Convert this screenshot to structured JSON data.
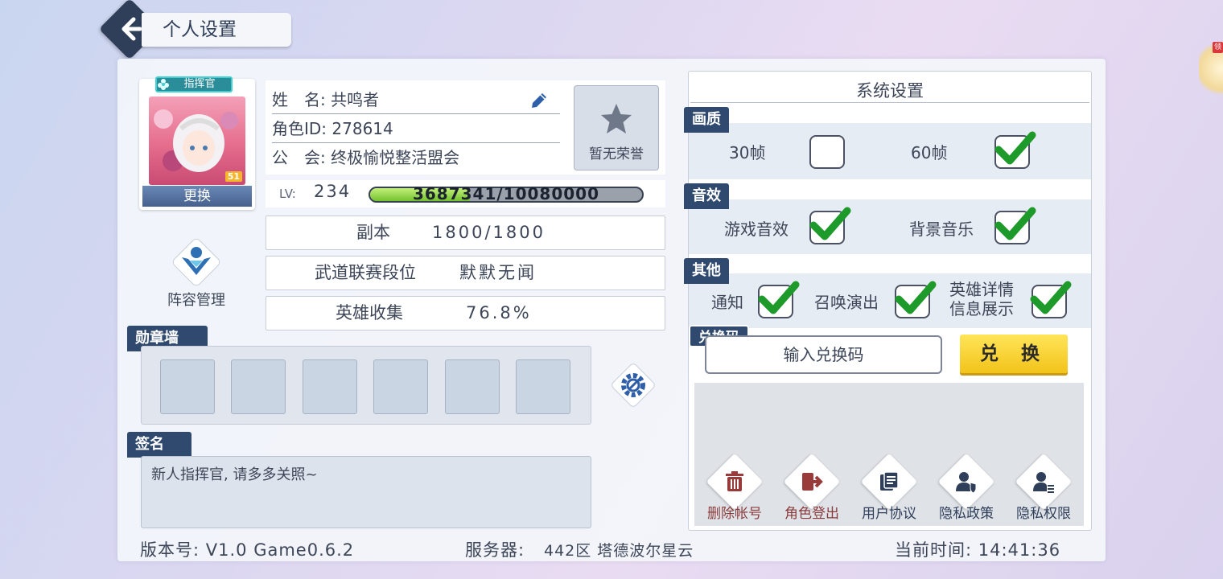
{
  "header": {
    "title": "个人设置"
  },
  "profile": {
    "avatar_tag": "指挥官",
    "avatar_change": "更换",
    "avatar_level_badge": "51",
    "name_label": "姓　名:",
    "name_value": "共鸣者",
    "role_id_label": "角色ID:",
    "role_id_value": "278614",
    "guild_label": "公　会:",
    "guild_value": "终极愉悦整活盟会",
    "honor_label": "暂无荣誉",
    "lv_label": "LV:",
    "lv_value": "234",
    "exp_text": "3687341/10080000",
    "exp_fraction": 0.366
  },
  "stats": [
    {
      "label": "副本",
      "value": "1800/1800"
    },
    {
      "label": "武道联赛段位",
      "value": "默默无闻"
    },
    {
      "label": "英雄收集",
      "value": "76.8%"
    }
  ],
  "lineup": {
    "label": "阵容管理"
  },
  "medal_wall": {
    "title": "勋章墙",
    "slots": 6
  },
  "signature": {
    "title": "签名",
    "text": "新人指挥官, 请多多关照~"
  },
  "footer": {
    "version": "版本号: V1.0 Game0.6.2",
    "server_label": "服务器:",
    "server_value": "442区 塔德波尔星云",
    "time": "当前时间: 14:41:36"
  },
  "system": {
    "title": "系统设置",
    "quality_title": "画质",
    "fps30": "30帧",
    "fps30_checked": false,
    "fps60": "60帧",
    "fps60_checked": true,
    "sound_title": "音效",
    "game_sound": "游戏音效",
    "game_sound_checked": true,
    "bg_music": "背景音乐",
    "bg_music_checked": true,
    "other_title": "其他",
    "notify": "通知",
    "notify_checked": true,
    "summon_show": "召唤演出",
    "summon_checked": true,
    "hero_detail_line1": "英雄详情",
    "hero_detail_line2": "信息展示",
    "hero_detail_checked": true,
    "redeem_title": "兑换码",
    "redeem_placeholder": "输入兑换码",
    "redeem_button": "兑 换",
    "account_actions": [
      {
        "label": "删除帐号",
        "icon": "trash-icon",
        "color": "#8a3b3b"
      },
      {
        "label": "角色登出",
        "icon": "logout-icon",
        "color": "#8a3b3b"
      },
      {
        "label": "用户协议",
        "icon": "document-icon",
        "color": "#2f3f5a"
      },
      {
        "label": "隐私政策",
        "icon": "privacy-shield-icon",
        "color": "#2f3f5a"
      },
      {
        "label": "隐私权限",
        "icon": "user-permission-icon",
        "color": "#2f3f5a"
      }
    ]
  },
  "corner_badge": {
    "text": "领"
  }
}
